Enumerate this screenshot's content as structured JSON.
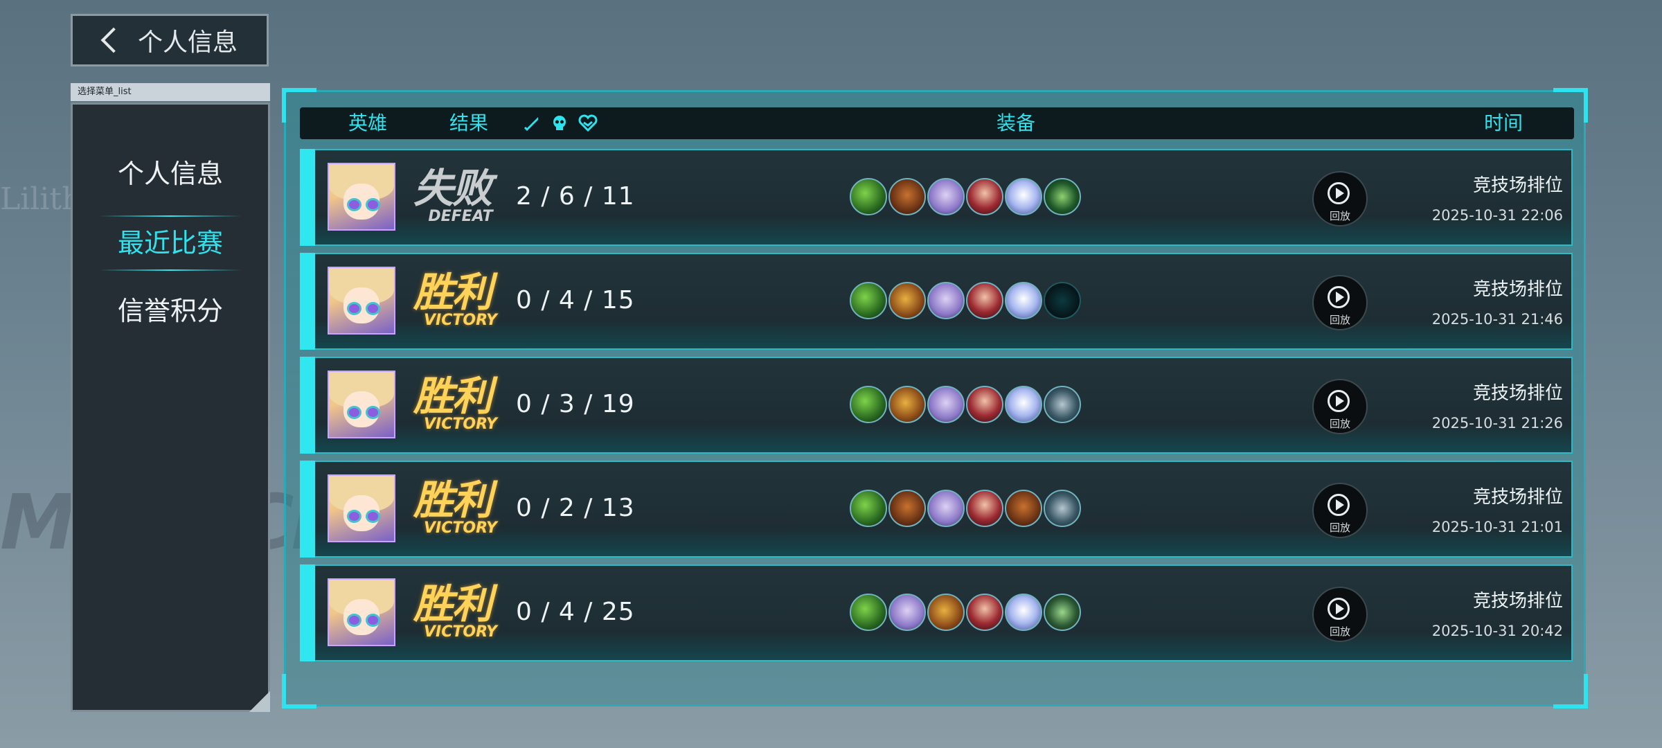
{
  "back_button": {
    "label": "个人信息"
  },
  "sidebar": {
    "tag": "选择菜单_list",
    "items": [
      {
        "label": "个人信息",
        "active": false
      },
      {
        "label": "最近比赛",
        "active": true
      },
      {
        "label": "信誉积分",
        "active": false
      }
    ]
  },
  "background": {
    "logo_text": "MBRACING",
    "side_text": "Lilith"
  },
  "header": {
    "hero": "英雄",
    "result": "结果",
    "kill_icon": "sword-icon",
    "death_icon": "skull-icon",
    "assist_icon": "handshake-icon",
    "equipment": "装备",
    "time": "时间"
  },
  "matches": [
    {
      "result_cn": "失败",
      "result_en": "DEFEAT",
      "result_type": "defeat",
      "kda": "2 / 6 / 11",
      "items": [
        "green",
        "brown",
        "lilac",
        "red",
        "blue",
        "emerald"
      ],
      "replay_label": "回放",
      "mode": "竞技场排位",
      "time": "2025-10-31 22:06"
    },
    {
      "result_cn": "胜利",
      "result_en": "VICTORY",
      "result_type": "victory",
      "kda": "0 / 4 / 15",
      "items": [
        "green",
        "gold",
        "lilac",
        "red",
        "blue",
        "empty"
      ],
      "replay_label": "回放",
      "mode": "竞技场排位",
      "time": "2025-10-31 21:46"
    },
    {
      "result_cn": "胜利",
      "result_en": "VICTORY",
      "result_type": "victory",
      "kda": "0 / 3 / 19",
      "items": [
        "green",
        "gold",
        "lilac",
        "red",
        "blue",
        "steel"
      ],
      "replay_label": "回放",
      "mode": "竞技场排位",
      "time": "2025-10-31 21:26"
    },
    {
      "result_cn": "胜利",
      "result_en": "VICTORY",
      "result_type": "victory",
      "kda": "0 / 2 / 13",
      "items": [
        "green",
        "brown",
        "lilac",
        "red",
        "brown",
        "steel"
      ],
      "replay_label": "回放",
      "mode": "竞技场排位",
      "time": "2025-10-31 21:01"
    },
    {
      "result_cn": "胜利",
      "result_en": "VICTORY",
      "result_type": "victory",
      "kda": "0 / 4 / 25",
      "items": [
        "green",
        "lilac",
        "gold",
        "red",
        "blue",
        "darkgreen"
      ],
      "replay_label": "回放",
      "mode": "竞技场排位",
      "time": "2025-10-31 20:42"
    }
  ],
  "colors": {
    "accent": "#2fe3ee",
    "victory": "#ffd35a",
    "defeat": "#c9cdd0"
  }
}
